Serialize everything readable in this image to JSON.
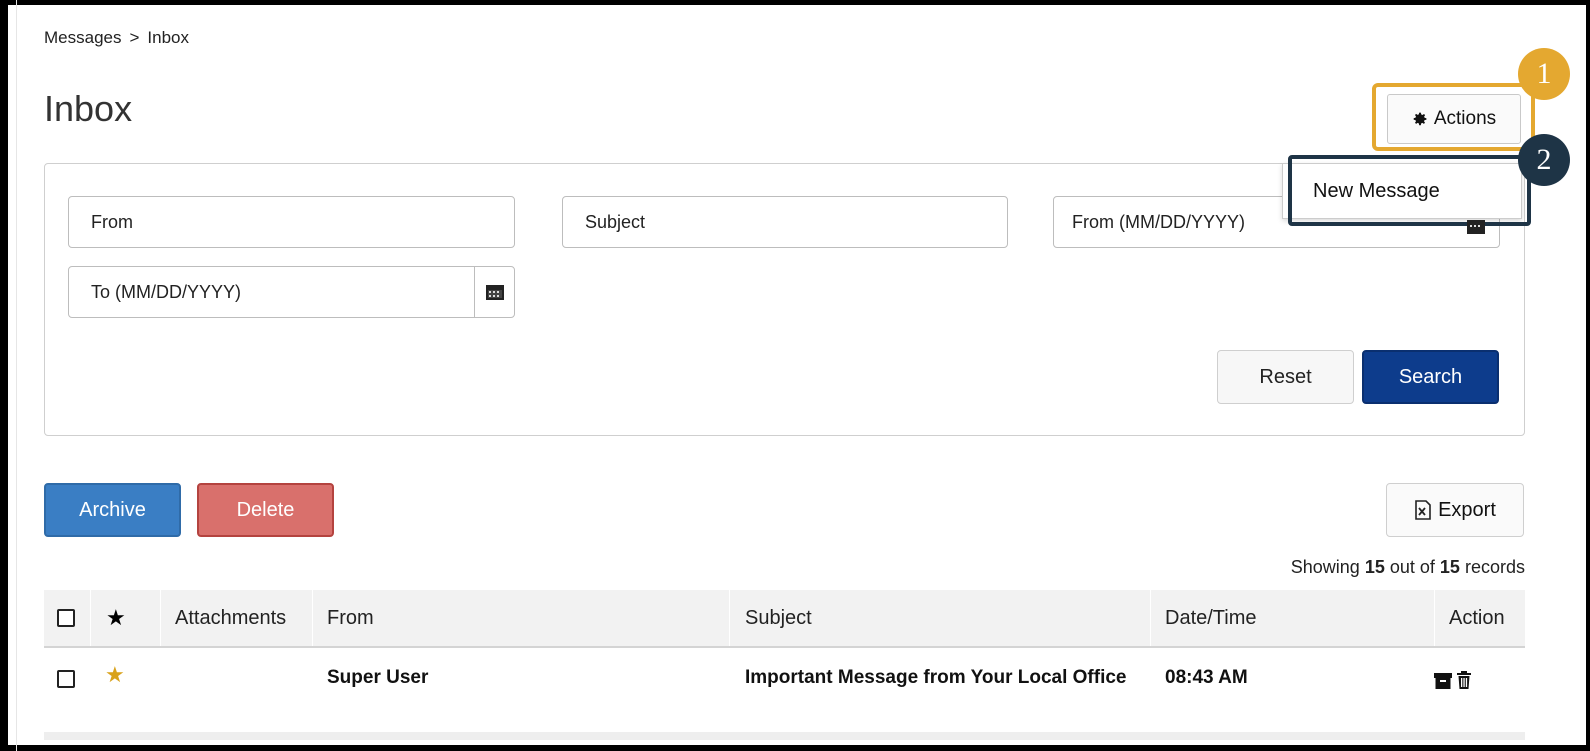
{
  "breadcrumb": {
    "parent": "Messages",
    "separator": ">",
    "current": "Inbox"
  },
  "page": {
    "title": "Inbox"
  },
  "actions": {
    "label": "Actions",
    "menu_item": "New Message"
  },
  "callouts": {
    "one": "1",
    "two": "2"
  },
  "filters": {
    "from_placeholder": "From",
    "subject_placeholder": "Subject",
    "date_from_placeholder": "From (MM/DD/YYYY)",
    "date_to_placeholder": "To (MM/DD/YYYY)",
    "reset_label": "Reset",
    "search_label": "Search"
  },
  "bulk": {
    "archive_label": "Archive",
    "delete_label": "Delete",
    "export_label": "Export"
  },
  "records": {
    "prefix": "Showing",
    "shown": "15",
    "middle": "out of",
    "total": "15",
    "suffix": "records"
  },
  "table": {
    "headers": {
      "attachments": "Attachments",
      "from": "From",
      "subject": "Subject",
      "datetime": "Date/Time",
      "action": "Action"
    },
    "rows": [
      {
        "from": "Super User",
        "subject": "Important Message from Your Local Office",
        "datetime": "08:43 AM",
        "starred": true
      }
    ]
  },
  "colors": {
    "search": "#0d3c8c",
    "archive": "#3a7ec4",
    "delete": "#d9706c",
    "callout1": "#e4a830",
    "callout2": "#1e3446"
  }
}
